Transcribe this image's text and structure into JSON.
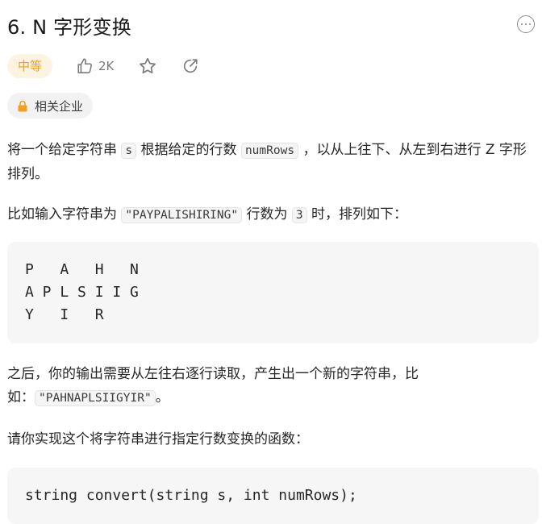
{
  "problem": {
    "title": "6. N 字形变换",
    "difficulty": "中等",
    "likes": "2K",
    "company_tag": "相关企业"
  },
  "description": {
    "p1_a": "将一个给定字符串 ",
    "p1_code_s": "s",
    "p1_b": " 根据给定的行数 ",
    "p1_code_rows": "numRows",
    "p1_c": " ，以从上往下、从左到右进行 Z 字形排列。",
    "p2_a": "比如输入字符串为 ",
    "p2_code_str": "\"PAYPALISHIRING\"",
    "p2_b": " 行数为 ",
    "p2_code_num": "3",
    "p2_c": " 时，排列如下：",
    "zigzag": "P   A   H   N\nA P L S I I G\nY   I   R",
    "p3_a": "之后，你的输出需要从左往右逐行读取，产生出一个新的字符串，比如：",
    "p3_code": "\"PAHNAPLSIIGYIR\"",
    "p3_b": "。",
    "p4": "请你实现这个将字符串进行指定行数变换的函数：",
    "signature": "string convert(string s, int numRows);"
  },
  "icons": {
    "more": "more-horizontal-icon",
    "like": "thumbs-up-icon",
    "star": "star-icon",
    "share": "share-icon",
    "lock": "lock-icon"
  },
  "colors": {
    "difficulty_text": "#f0a020",
    "difficulty_bg": "#fdf3e1",
    "lock": "#f0a020"
  }
}
